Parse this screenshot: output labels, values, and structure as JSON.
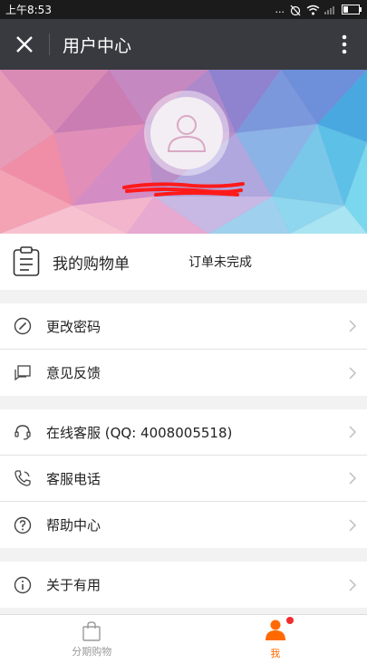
{
  "status_bar": {
    "time": "上午8:53",
    "dots": "..."
  },
  "header": {
    "title": "用户中心"
  },
  "orders": {
    "label": "我的购物单",
    "status": "订单未完成"
  },
  "group1": [
    {
      "icon": "pencil-circle-icon",
      "label": "更改密码"
    },
    {
      "icon": "feedback-chat-icon",
      "label": "意见反馈"
    }
  ],
  "group2": [
    {
      "icon": "headset-icon",
      "label": "在线客服 (QQ: 4008005518)"
    },
    {
      "icon": "phone-icon",
      "label": "客服电话"
    },
    {
      "icon": "help-circle-icon",
      "label": "帮助中心"
    }
  ],
  "group3": [
    {
      "icon": "info-circle-icon",
      "label": "关于有用"
    }
  ],
  "tabbar": {
    "tabs": [
      {
        "label": "分期购物",
        "icon": "shopping-bag-icon",
        "active": false
      },
      {
        "label": "我",
        "icon": "person-icon",
        "active": true
      }
    ]
  },
  "colors": {
    "accent": "#ff6a00",
    "titlebar": "#393a3f",
    "badge": "#f02c2c"
  }
}
